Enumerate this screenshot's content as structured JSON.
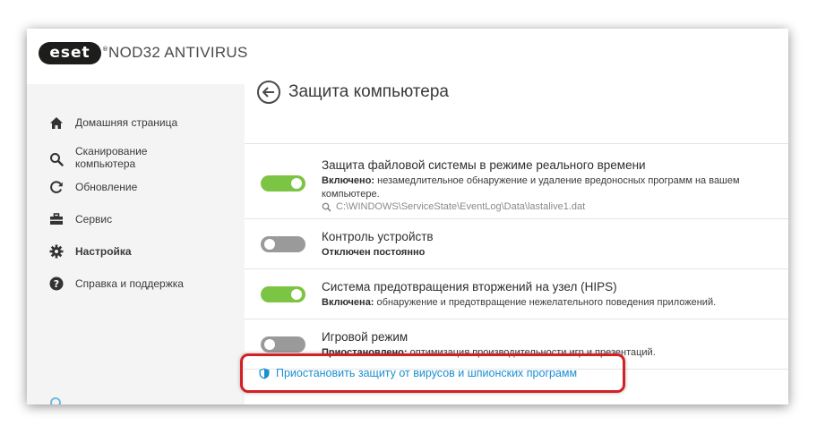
{
  "app": {
    "logo": "eset",
    "product_name": "NOD32 ANTIVIRUS"
  },
  "sidebar": {
    "items": [
      {
        "label": "Домашняя страница",
        "icon": "home-icon",
        "active": false
      },
      {
        "label": "Сканирование\nкомпьютера",
        "icon": "search-icon",
        "active": false
      },
      {
        "label": "Обновление",
        "icon": "refresh-icon",
        "active": false
      },
      {
        "label": "Сервис",
        "icon": "toolbox-icon",
        "active": false
      },
      {
        "label": "Настройка",
        "icon": "gear-icon",
        "active": true
      },
      {
        "label": "Справка и поддержка",
        "icon": "help-icon",
        "active": false
      }
    ]
  },
  "page": {
    "title": "Защита компьютера"
  },
  "settings": [
    {
      "title": "Защита файловой системы в режиме реального времени",
      "state_label": "Включено:",
      "desc": " незамедлительное обнаружение и удаление вредоносных программ на вашем компьютере.",
      "path": "C:\\WINDOWS\\ServiceState\\EventLog\\Data\\lastalive1.dat",
      "enabled": true
    },
    {
      "title": "Контроль устройств",
      "state_label": "Отключен постоянно",
      "desc": "",
      "enabled": false
    },
    {
      "title": "Система предотвращения вторжений на узел (HIPS)",
      "state_label": "Включена:",
      "desc": " обнаружение и предотвращение нежелательного поведения приложений.",
      "enabled": true
    },
    {
      "title": "Игровой режим",
      "state_label": "Приостановлено:",
      "desc": " оптимизация производительности игр и презентаций.",
      "enabled": false
    }
  ],
  "pause_link": {
    "label": "Приостановить защиту от вирусов и шпионских программ"
  },
  "colors": {
    "toggle_on": "#7cc444",
    "toggle_off": "#9a9a9a",
    "link": "#1a8fd1",
    "highlight": "#d22024"
  }
}
